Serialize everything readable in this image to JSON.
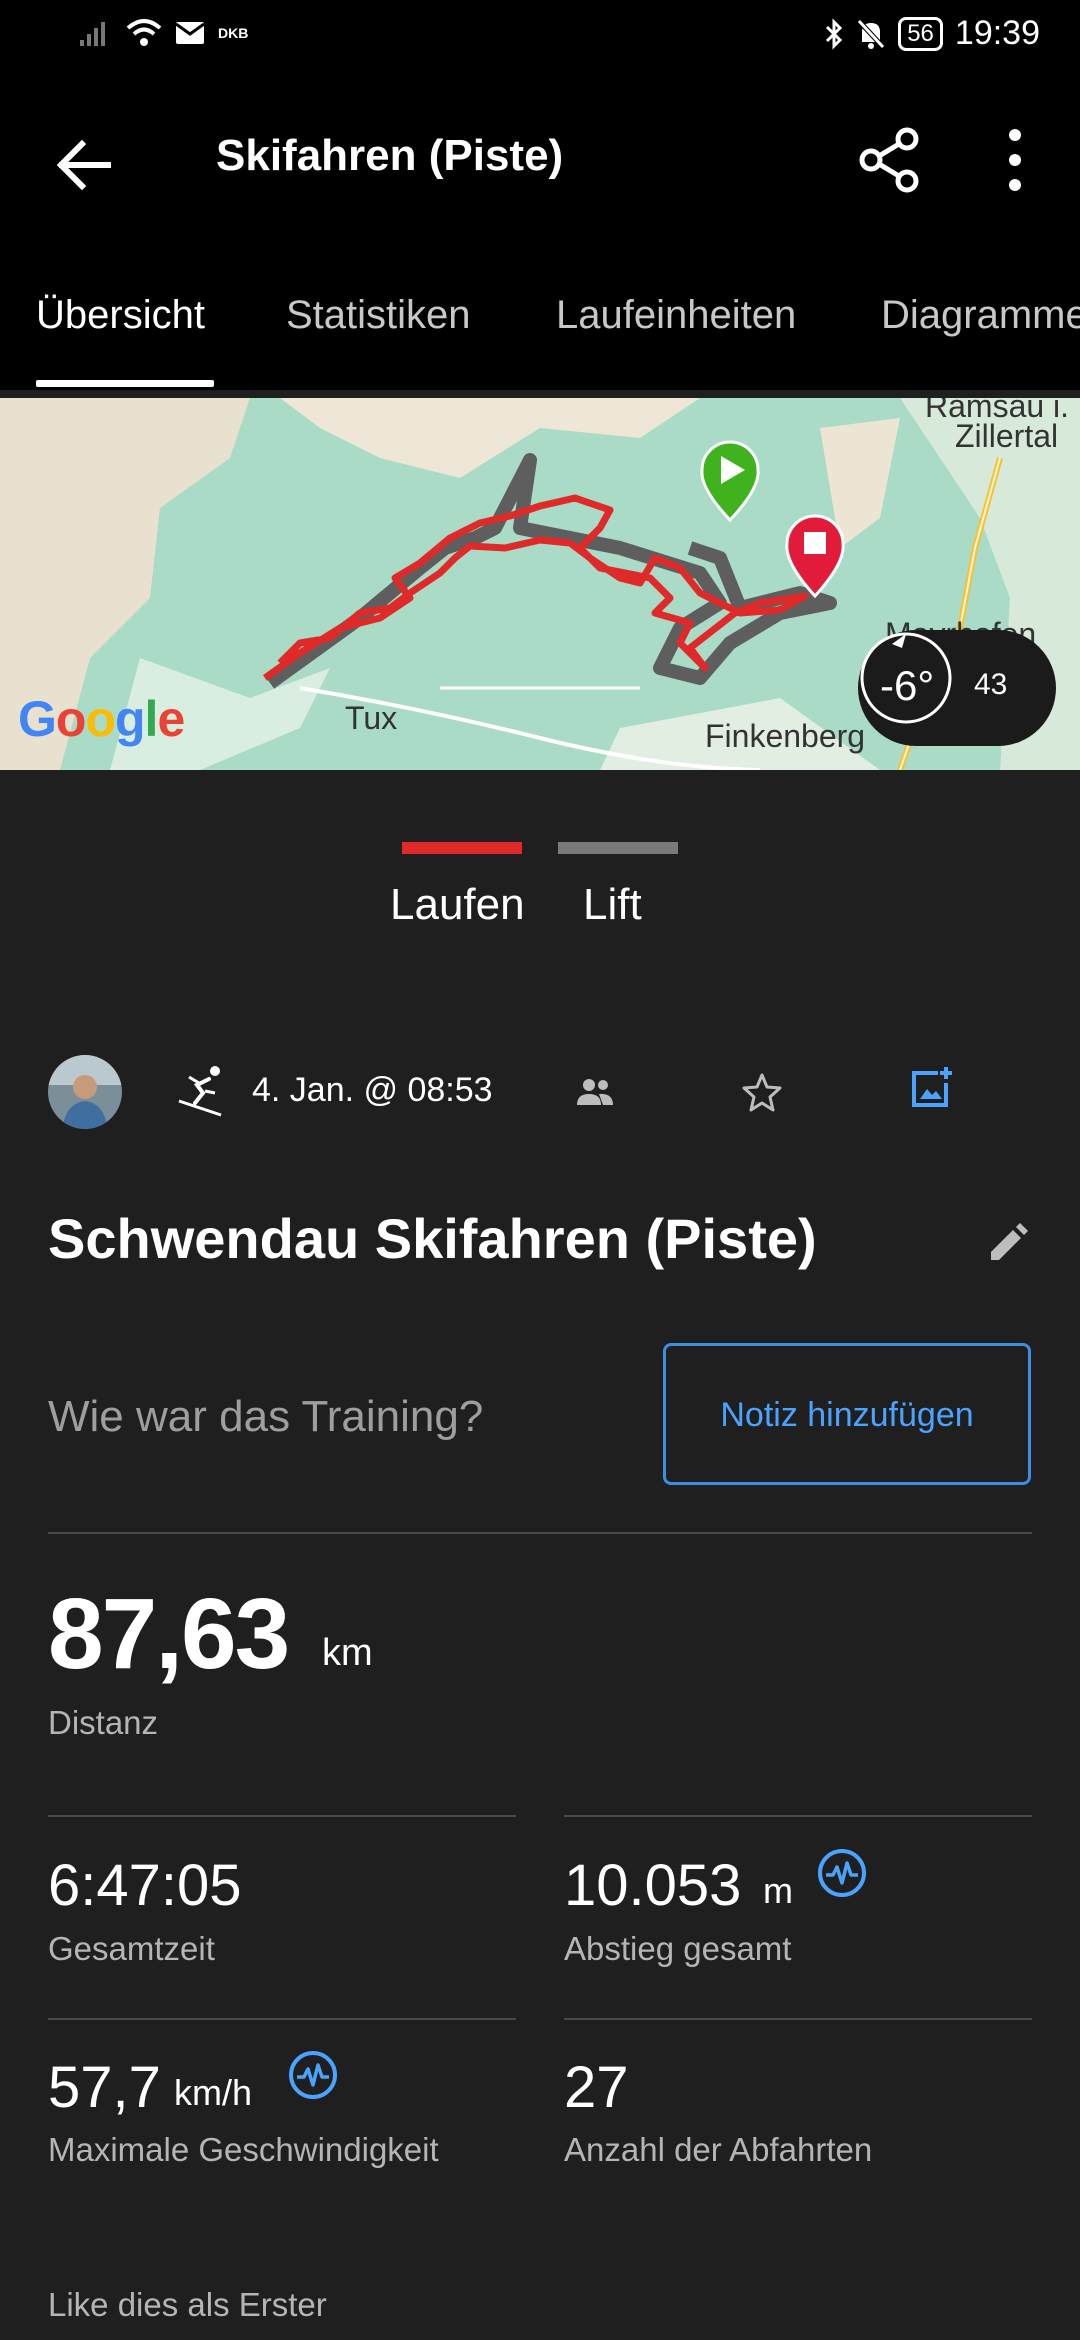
{
  "status_bar": {
    "carrier_tag": "DKB",
    "battery": "56",
    "time": "19:39"
  },
  "app_bar": {
    "title": "Skifahren (Piste)",
    "back_icon": "arrow-back-icon",
    "share_icon": "share-icon",
    "more_icon": "more-vert-icon"
  },
  "tabs": [
    {
      "label": "Übersicht",
      "active": true
    },
    {
      "label": "Statistiken",
      "active": false
    },
    {
      "label": "Laufeinheiten",
      "active": false
    },
    {
      "label": "Diagramme",
      "active": false
    }
  ],
  "map": {
    "places": [
      "Ramsau i.",
      "Zillertal",
      "Tux",
      "Finkenberg",
      "Mayrhofen"
    ],
    "attribution": "Google",
    "temperature": "-6°",
    "wind_value": "43",
    "track_color": "#e02a2a",
    "lift_color": "#5e5e5e"
  },
  "legend": {
    "run_label": "Laufen",
    "lift_label": "Lift",
    "run_color": "#e02a2a",
    "lift_color": "#7a7a7a"
  },
  "activity": {
    "date": "4. Jan. @ 08:53",
    "name": "Schwendau Skifahren (Piste)",
    "prompt": "Wie war das Training?",
    "note_button": "Notiz hinzufügen"
  },
  "stats": {
    "distance": {
      "value": "87,63",
      "unit": "km",
      "label": "Distanz"
    },
    "total_time": {
      "value": "6:47:05",
      "label": "Gesamtzeit"
    },
    "descent": {
      "value": "10.053",
      "unit": "m",
      "label": "Abstieg gesamt"
    },
    "max_speed": {
      "value": "57,7",
      "unit": "km/h",
      "label": "Maximale Geschwindigkeit"
    },
    "runs": {
      "value": "27",
      "label": "Anzahl der Abfahrten"
    }
  },
  "social": {
    "like_text": "Like dies als Erster"
  },
  "colors": {
    "accent_blue": "#4aa3ff",
    "background": "#1f1f1f"
  }
}
